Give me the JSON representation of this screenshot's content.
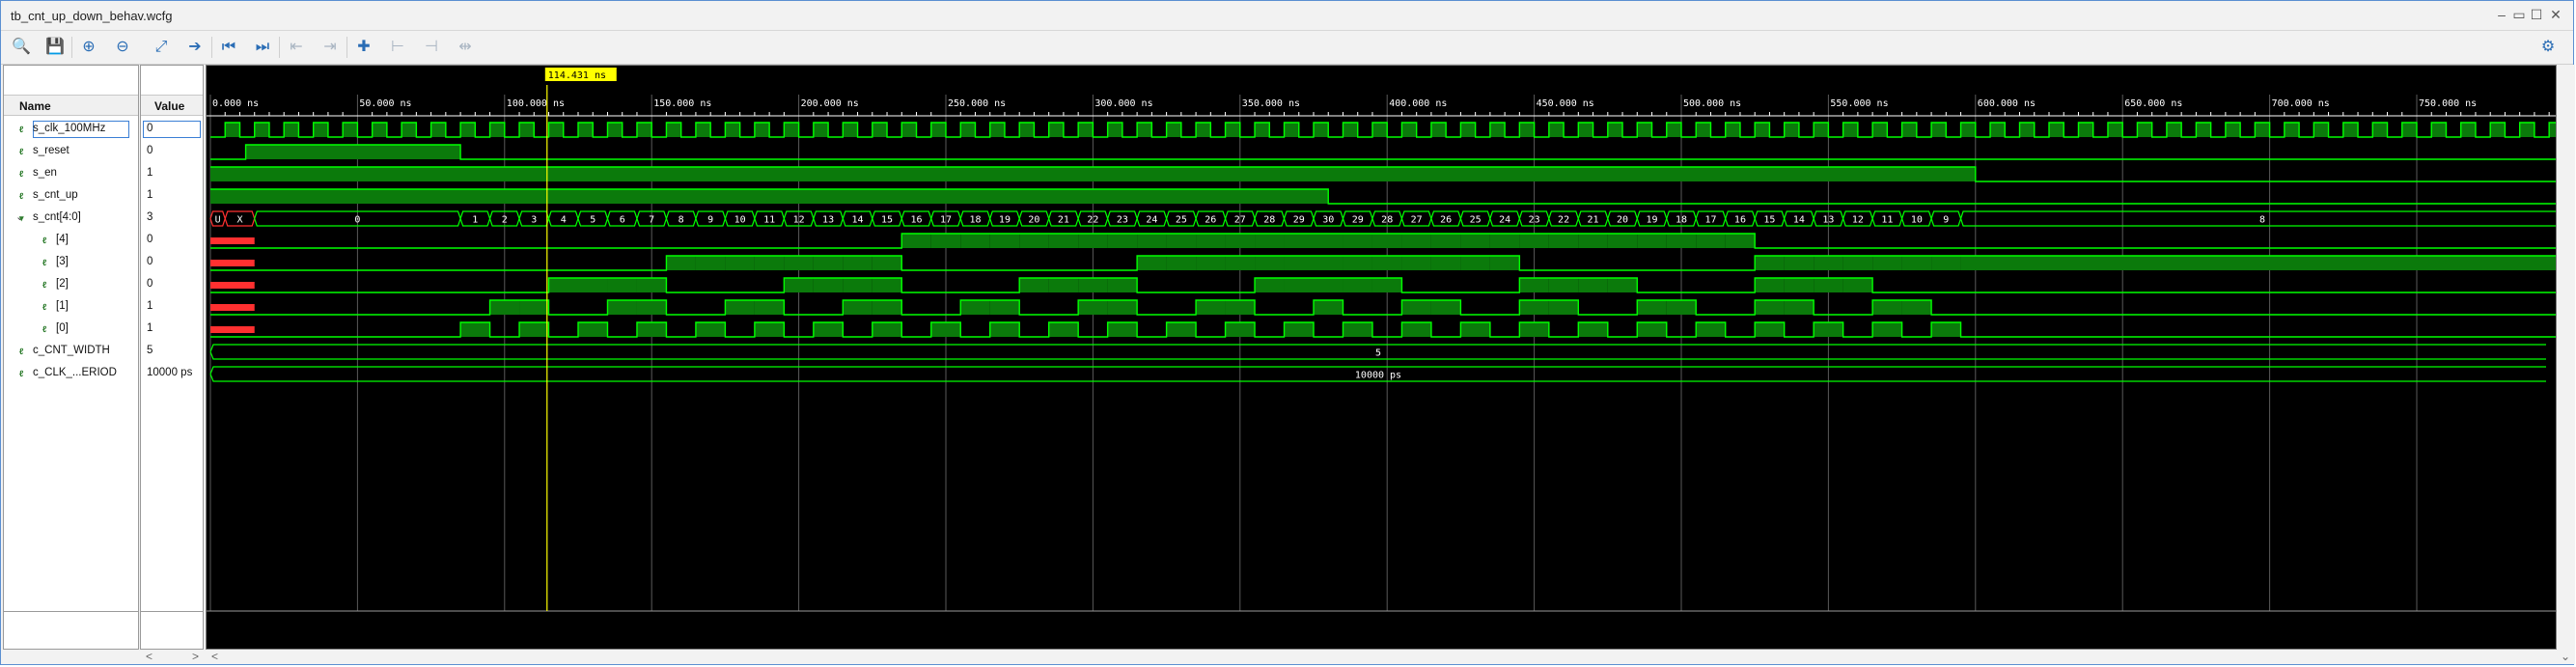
{
  "window": {
    "title": "tb_cnt_up_down_behav.wcfg",
    "controls": [
      "minimize",
      "restore",
      "maximize",
      "close"
    ]
  },
  "toolbar": {
    "buttons": [
      {
        "name": "search-icon",
        "glyph": "🔍",
        "enabled": true
      },
      {
        "name": "save-icon",
        "glyph": "💾",
        "enabled": true
      },
      {
        "name": "zoom-in-icon",
        "glyph": "⊕",
        "enabled": true
      },
      {
        "name": "zoom-out-icon",
        "glyph": "⊖",
        "enabled": true
      },
      {
        "name": "zoom-fit-icon",
        "glyph": "⤢",
        "enabled": true
      },
      {
        "name": "go-to-cursor-icon",
        "glyph": "➔",
        "enabled": true
      },
      {
        "name": "go-to-time-0-icon",
        "glyph": "⏮",
        "enabled": true
      },
      {
        "name": "go-to-last-time-icon",
        "glyph": "⏭",
        "enabled": true
      },
      {
        "name": "previous-transition-icon",
        "glyph": "⇤",
        "enabled": false
      },
      {
        "name": "next-transition-icon",
        "glyph": "⇥",
        "enabled": false
      },
      {
        "name": "add-marker-icon",
        "glyph": "✚",
        "enabled": true
      },
      {
        "name": "previous-marker-icon",
        "glyph": "⊢",
        "enabled": false
      },
      {
        "name": "next-marker-icon",
        "glyph": "⊣",
        "enabled": false
      },
      {
        "name": "swap-cursors-icon",
        "glyph": "⇹",
        "enabled": false
      }
    ],
    "settings_icon": "gear-icon"
  },
  "columns": {
    "name": "Name",
    "value": "Value"
  },
  "signals": [
    {
      "name": "s_clk_100MHz",
      "value": "0",
      "indent": 0,
      "selected": true
    },
    {
      "name": "s_reset",
      "value": "0",
      "indent": 0
    },
    {
      "name": "s_en",
      "value": "1",
      "indent": 0
    },
    {
      "name": "s_cnt_up",
      "value": "1",
      "indent": 0
    },
    {
      "name": "s_cnt[4:0]",
      "value": "3",
      "indent": 0,
      "bus": true,
      "expanded": true
    },
    {
      "name": "[4]",
      "value": "0",
      "indent": 1
    },
    {
      "name": "[3]",
      "value": "0",
      "indent": 1
    },
    {
      "name": "[2]",
      "value": "0",
      "indent": 1
    },
    {
      "name": "[1]",
      "value": "1",
      "indent": 1
    },
    {
      "name": "[0]",
      "value": "1",
      "indent": 1
    },
    {
      "name": "c_CNT_WIDTH",
      "value": "5",
      "indent": 0
    },
    {
      "name": "c_CLK_...ERIOD",
      "value": "10000 ps",
      "indent": 0
    }
  ],
  "timeline": {
    "cursor_label": "114.431 ns",
    "cursor_time_ns": 114.431,
    "range_ns": [
      0,
      800
    ],
    "ticks": [
      "0.000 ns",
      "50.000 ns",
      "100.000 ns",
      "150.000 ns",
      "200.000 ns",
      "250.000 ns",
      "300.000 ns",
      "350.000 ns",
      "400.000 ns",
      "450.000 ns",
      "500.000 ns",
      "550.000 ns",
      "600.000 ns",
      "650.000 ns",
      "700.000 ns",
      "750.000 ns"
    ]
  },
  "waveforms": {
    "clk_period_ns": 10,
    "reset_pulse_ns": [
      12,
      85
    ],
    "en_high_until_ns": 600,
    "cnt_up_high_until_ns": 380,
    "bus_segments": [
      {
        "label": "U",
        "start": 0,
        "end": 5,
        "undef": true
      },
      {
        "label": "X",
        "start": 5,
        "end": 15,
        "undef": true
      },
      {
        "label": "0",
        "start": 15,
        "end": 85
      },
      {
        "label": "1",
        "start": 85,
        "end": 95
      },
      {
        "label": "2",
        "start": 95,
        "end": 105
      },
      {
        "label": "3",
        "start": 105,
        "end": 115
      },
      {
        "label": "4",
        "start": 115,
        "end": 125
      },
      {
        "label": "5",
        "start": 125,
        "end": 135
      },
      {
        "label": "6",
        "start": 135,
        "end": 145
      },
      {
        "label": "7",
        "start": 145,
        "end": 155
      },
      {
        "label": "8",
        "start": 155,
        "end": 165
      },
      {
        "label": "9",
        "start": 165,
        "end": 175
      },
      {
        "label": "10",
        "start": 175,
        "end": 185
      },
      {
        "label": "11",
        "start": 185,
        "end": 195
      },
      {
        "label": "12",
        "start": 195,
        "end": 205
      },
      {
        "label": "13",
        "start": 205,
        "end": 215
      },
      {
        "label": "14",
        "start": 215,
        "end": 225
      },
      {
        "label": "15",
        "start": 225,
        "end": 235
      },
      {
        "label": "16",
        "start": 235,
        "end": 245
      },
      {
        "label": "17",
        "start": 245,
        "end": 255
      },
      {
        "label": "18",
        "start": 255,
        "end": 265
      },
      {
        "label": "19",
        "start": 265,
        "end": 275
      },
      {
        "label": "20",
        "start": 275,
        "end": 285
      },
      {
        "label": "21",
        "start": 285,
        "end": 295
      },
      {
        "label": "22",
        "start": 295,
        "end": 305
      },
      {
        "label": "23",
        "start": 305,
        "end": 315
      },
      {
        "label": "24",
        "start": 315,
        "end": 325
      },
      {
        "label": "25",
        "start": 325,
        "end": 335
      },
      {
        "label": "26",
        "start": 335,
        "end": 345
      },
      {
        "label": "27",
        "start": 345,
        "end": 355
      },
      {
        "label": "28",
        "start": 355,
        "end": 365
      },
      {
        "label": "29",
        "start": 365,
        "end": 375
      },
      {
        "label": "30",
        "start": 375,
        "end": 385
      },
      {
        "label": "29",
        "start": 385,
        "end": 395
      },
      {
        "label": "28",
        "start": 395,
        "end": 405
      },
      {
        "label": "27",
        "start": 405,
        "end": 415
      },
      {
        "label": "26",
        "start": 415,
        "end": 425
      },
      {
        "label": "25",
        "start": 425,
        "end": 435
      },
      {
        "label": "24",
        "start": 435,
        "end": 445
      },
      {
        "label": "23",
        "start": 445,
        "end": 455
      },
      {
        "label": "22",
        "start": 455,
        "end": 465
      },
      {
        "label": "21",
        "start": 465,
        "end": 475
      },
      {
        "label": "20",
        "start": 475,
        "end": 485
      },
      {
        "label": "19",
        "start": 485,
        "end": 495
      },
      {
        "label": "18",
        "start": 495,
        "end": 505
      },
      {
        "label": "17",
        "start": 505,
        "end": 515
      },
      {
        "label": "16",
        "start": 515,
        "end": 525
      },
      {
        "label": "15",
        "start": 525,
        "end": 535
      },
      {
        "label": "14",
        "start": 535,
        "end": 545
      },
      {
        "label": "13",
        "start": 545,
        "end": 555
      },
      {
        "label": "12",
        "start": 555,
        "end": 565
      },
      {
        "label": "11",
        "start": 565,
        "end": 575
      },
      {
        "label": "10",
        "start": 575,
        "end": 585
      },
      {
        "label": "9",
        "start": 585,
        "end": 595
      },
      {
        "label": "8",
        "start": 595,
        "end": 800
      }
    ],
    "const_width_value": "5",
    "const_period_value": "10000 ps"
  },
  "colors": {
    "wave": "#00ff00",
    "wave_fill": "#0b7a0b",
    "cursor": "#ffff00",
    "undefined": "#ff3030",
    "grid": "#5a5a5a",
    "background": "#000000"
  }
}
